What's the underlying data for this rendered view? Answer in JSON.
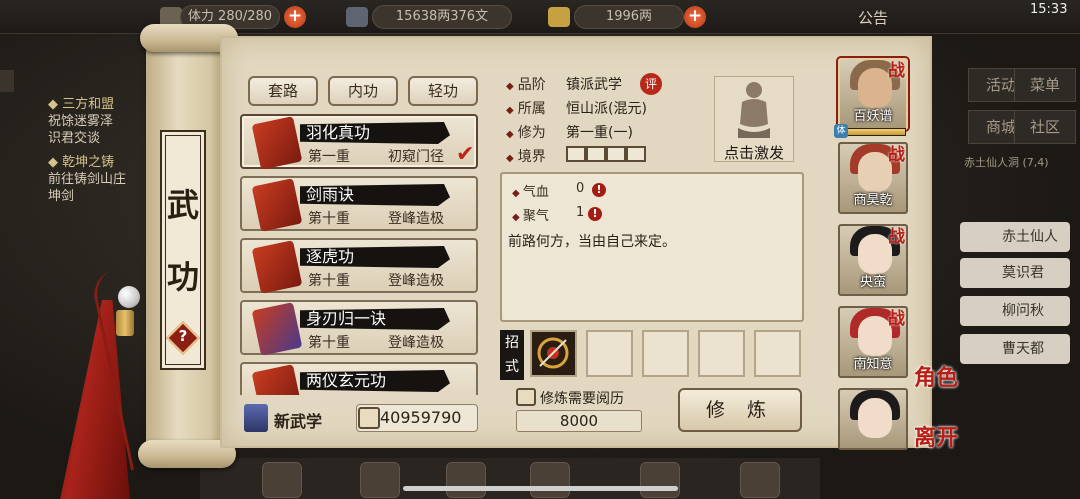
{
  "status_bar": {
    "time": "15:33",
    "notice_label": "公告"
  },
  "resources": {
    "stamina": "体力 280/280",
    "money": "15638两376文",
    "gold": "1996两"
  },
  "background_quests": [
    {
      "title": "三方和盟",
      "desc": [
        "祝馀迷雾泽",
        "识君交谈"
      ]
    },
    {
      "title": "乾坤之铸",
      "desc": [
        "前往铸剑山庄",
        "坤剑"
      ]
    }
  ],
  "background_menu": {
    "buttons": [
      "活动",
      "菜单",
      "商城",
      "社区"
    ],
    "location": "赤土仙人洞 (7,4)",
    "npcs": [
      "赤土仙人洞",
      "莫识君",
      "柳问秋",
      "曹天都"
    ]
  },
  "scroll": {
    "title_chars": [
      "武",
      "功"
    ],
    "help_icon": "question-diamond-icon"
  },
  "tabs": [
    "套路",
    "内功",
    "轻功"
  ],
  "skills": [
    {
      "name": "羽化真功",
      "level": "第一重",
      "rank": "初窥门径",
      "selected": true
    },
    {
      "name": "剑雨诀",
      "level": "第十重",
      "rank": "登峰造极",
      "selected": false
    },
    {
      "name": "逐虎功",
      "level": "第十重",
      "rank": "登峰造极",
      "selected": false
    },
    {
      "name": "身刃归一诀",
      "level": "第十重",
      "rank": "登峰造极",
      "selected": false
    },
    {
      "name": "两仪玄元功",
      "level": "",
      "rank": "",
      "selected": false
    }
  ],
  "bottom_left": {
    "new_skill_label": "新武学",
    "experience_value": "40959790"
  },
  "detail": {
    "attrs": [
      {
        "label": "品阶",
        "value": "镇派武学"
      },
      {
        "label": "所属",
        "value": "恒山派(混元)"
      },
      {
        "label": "修为",
        "value": "第一重(一)"
      },
      {
        "label": "境界",
        "value": ""
      }
    ],
    "rating_badge": "评",
    "realm_boxes": 4,
    "portrait_label": "点击激发",
    "stats": [
      {
        "label": "气血",
        "value": "0"
      },
      {
        "label": "聚气",
        "value": "1"
      }
    ],
    "description": "前路何方，当由自己来定。",
    "moves_label": [
      "招",
      "式"
    ],
    "train_requirement_label": "修炼需要阅历",
    "train_requirement_value": "8000",
    "train_button": "修 炼"
  },
  "characters": [
    {
      "name": "百妖谱",
      "tag": "战",
      "selected": true,
      "hp_badge": "体",
      "hp_fraction": 1.0
    },
    {
      "name": "商昊乾",
      "tag": "战",
      "selected": false
    },
    {
      "name": "央蛮",
      "tag": "战",
      "selected": false
    },
    {
      "name": "南知意",
      "tag": "战",
      "selected": false
    },
    {
      "name": "",
      "tag": "",
      "selected": false
    }
  ],
  "side_buttons": {
    "role": "角色",
    "leave": "离开"
  },
  "colors": {
    "accent_red": "#b81f14",
    "parchment": "#e2d8c1",
    "ink": "#151210"
  }
}
